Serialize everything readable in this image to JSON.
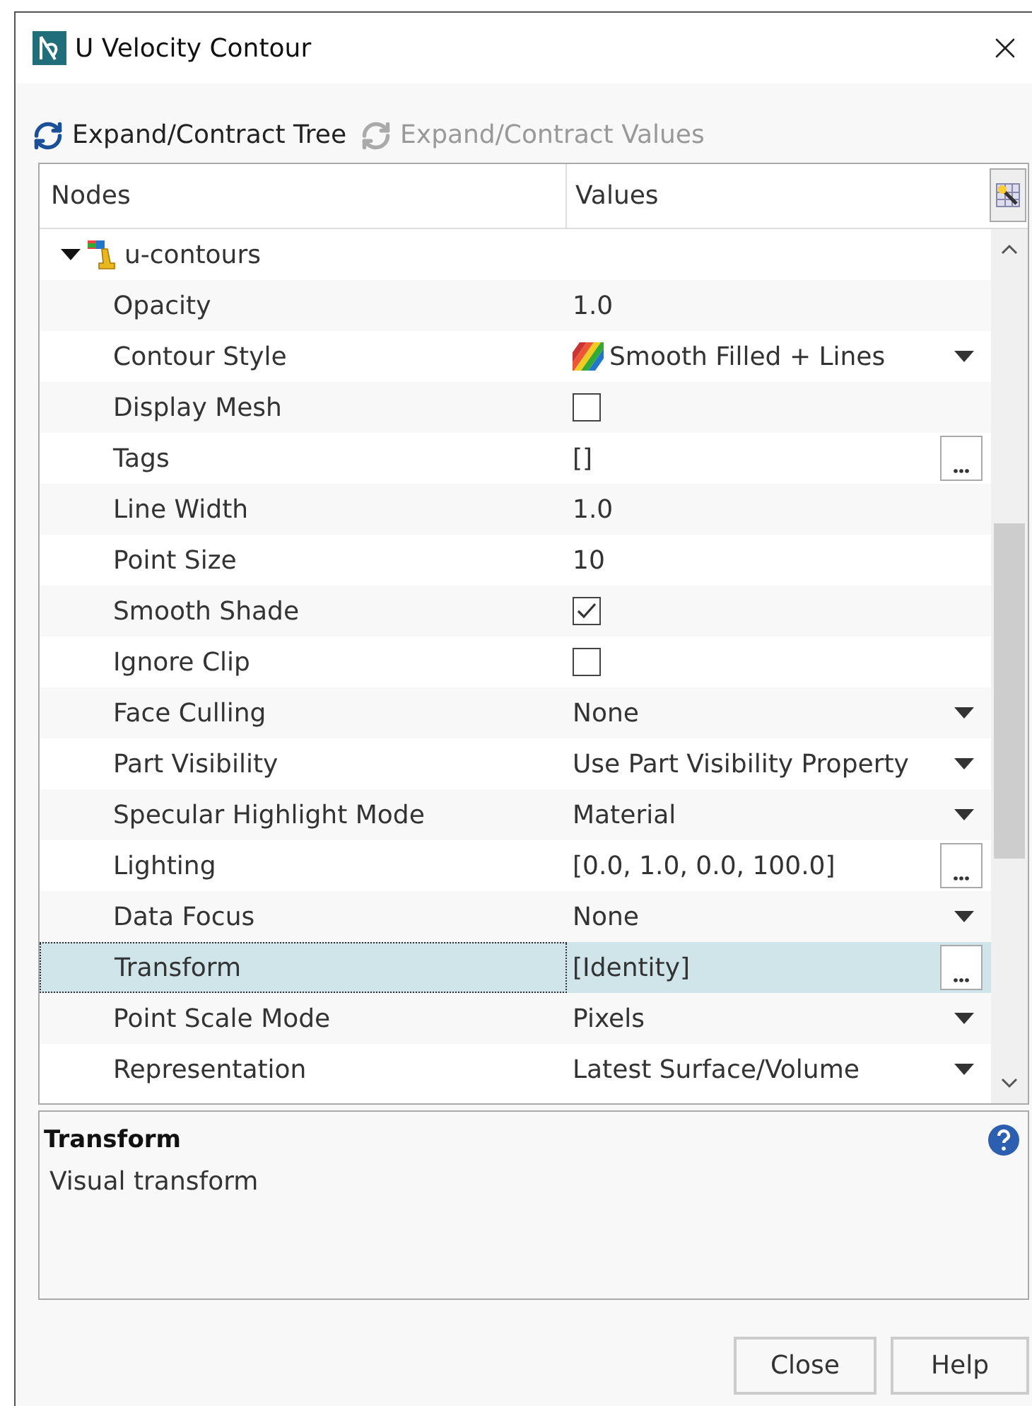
{
  "window": {
    "title": "U Velocity Contour"
  },
  "toolbar": [
    {
      "label": "Expand/Contract Tree",
      "disabled": false
    },
    {
      "label": "Expand/Contract Values",
      "disabled": true
    }
  ],
  "table": {
    "columns": [
      "Nodes",
      "Values"
    ],
    "root": {
      "label": "u-contours",
      "expanded": true
    },
    "rows": [
      {
        "name": "Opacity",
        "kind": "text",
        "value": "1.0",
        "selected": false
      },
      {
        "name": "Contour Style",
        "kind": "dropdown",
        "value": "Smooth Filled + Lines",
        "swatch": true,
        "selected": false
      },
      {
        "name": "Display Mesh",
        "kind": "checkbox",
        "checked": false,
        "selected": false
      },
      {
        "name": "Tags",
        "kind": "ellipsis",
        "value": "[]",
        "selected": false
      },
      {
        "name": "Line Width",
        "kind": "text",
        "value": "1.0",
        "selected": false
      },
      {
        "name": "Point Size",
        "kind": "text",
        "value": "10",
        "selected": false
      },
      {
        "name": "Smooth Shade",
        "kind": "checkbox",
        "checked": true,
        "selected": false
      },
      {
        "name": "Ignore Clip",
        "kind": "checkbox",
        "checked": false,
        "selected": false
      },
      {
        "name": "Face Culling",
        "kind": "dropdown",
        "value": "None",
        "selected": false
      },
      {
        "name": "Part Visibility",
        "kind": "dropdown",
        "value": "Use Part Visibility Property",
        "selected": false
      },
      {
        "name": "Specular Highlight Mode",
        "kind": "dropdown",
        "value": "Material",
        "selected": false
      },
      {
        "name": "Lighting",
        "kind": "ellipsis",
        "value": "[0.0, 1.0, 0.0, 100.0]",
        "selected": false
      },
      {
        "name": "Data Focus",
        "kind": "dropdown",
        "value": "None",
        "selected": false
      },
      {
        "name": "Transform",
        "kind": "ellipsis",
        "value": "[Identity]",
        "selected": true
      },
      {
        "name": "Point Scale Mode",
        "kind": "dropdown",
        "value": "Pixels",
        "selected": false
      },
      {
        "name": "Representation",
        "kind": "dropdown",
        "value": "Latest Surface/Volume",
        "selected": false
      }
    ]
  },
  "description": {
    "title": "Transform",
    "text": "Visual transform"
  },
  "buttons": [
    "Close",
    "Help"
  ]
}
